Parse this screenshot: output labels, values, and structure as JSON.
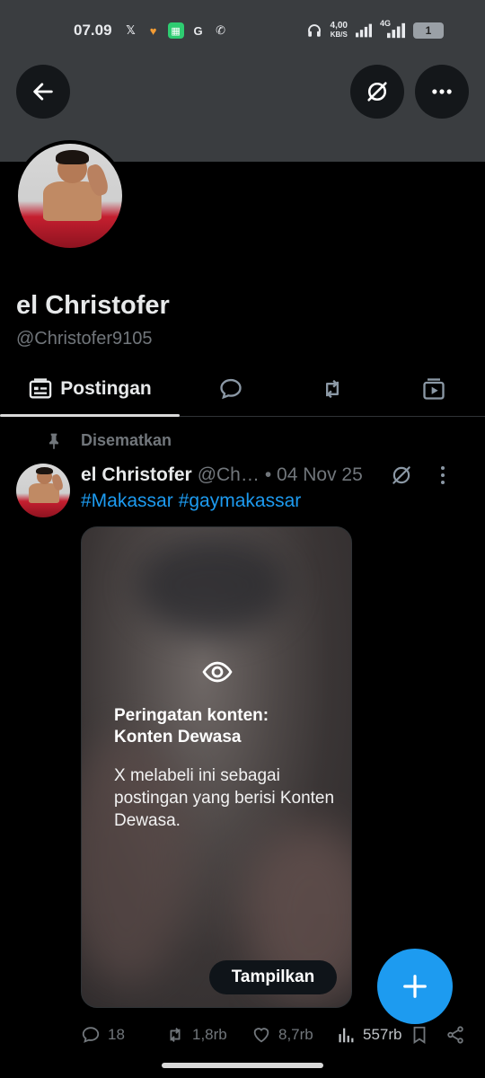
{
  "status_bar": {
    "time": "07.09",
    "speed_value": "4,00",
    "speed_unit": "KB/S",
    "network": "4G",
    "battery": "1"
  },
  "profile": {
    "name": "el Christofer",
    "handle": "@Christofer9105"
  },
  "tabs": [
    {
      "label": "Postingan",
      "icon": "posts-icon"
    },
    {
      "label": "",
      "icon": "reply-icon"
    },
    {
      "label": "",
      "icon": "repost-icon"
    },
    {
      "label": "",
      "icon": "media-icon"
    }
  ],
  "pinned_label": "Disematkan",
  "post": {
    "name": "el Christofer",
    "handle": "@Ch…",
    "date": "• 04 Nov 25",
    "hashtags": [
      "#Makassar",
      "#gaymakassar"
    ],
    "warning_title": "Peringatan konten: Konten Dewasa",
    "warning_body": "X melabeli ini sebagai postingan yang berisi Konten Dewasa.",
    "show_button": "Tampilkan",
    "stats": {
      "replies": "18",
      "reposts": "1,8rb",
      "likes": "8,7rb",
      "views": "557rb"
    }
  },
  "colors": {
    "accent": "#1d9bf0",
    "background": "#000000",
    "banner": "#3a3d40",
    "muted_text": "#71767b"
  }
}
